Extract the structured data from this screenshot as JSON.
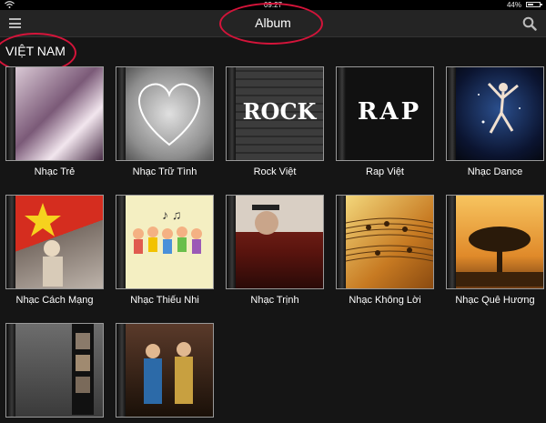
{
  "status_bar": {
    "time": "09:27",
    "battery": "44%"
  },
  "header": {
    "title": "Album"
  },
  "section": {
    "title": "VIỆT NAM"
  },
  "albums": [
    {
      "label": "Nhạc Trẻ",
      "art_text": ""
    },
    {
      "label": "Nhạc Trữ Tình",
      "art_text": ""
    },
    {
      "label": "Rock Việt",
      "art_text": "ROCK"
    },
    {
      "label": "Rap Việt",
      "art_text": "RAP"
    },
    {
      "label": "Nhạc Dance",
      "art_text": ""
    },
    {
      "label": "Nhạc Cách Mạng",
      "art_text": ""
    },
    {
      "label": "Nhạc Thiếu Nhi",
      "art_text": ""
    },
    {
      "label": "Nhạc Trịnh",
      "art_text": ""
    },
    {
      "label": "Nhạc Không Lời",
      "art_text": ""
    },
    {
      "label": "Nhạc Quê Hương",
      "art_text": ""
    },
    {
      "label": "",
      "art_text": ""
    },
    {
      "label": "",
      "art_text": ""
    }
  ],
  "colors": {
    "highlight_circle": "#d4143a",
    "background": "#151515",
    "header": "#242424"
  },
  "icons": {
    "menu": "hamburger-icon",
    "search": "search-icon",
    "wifi": "wifi-icon",
    "battery": "battery-icon"
  }
}
